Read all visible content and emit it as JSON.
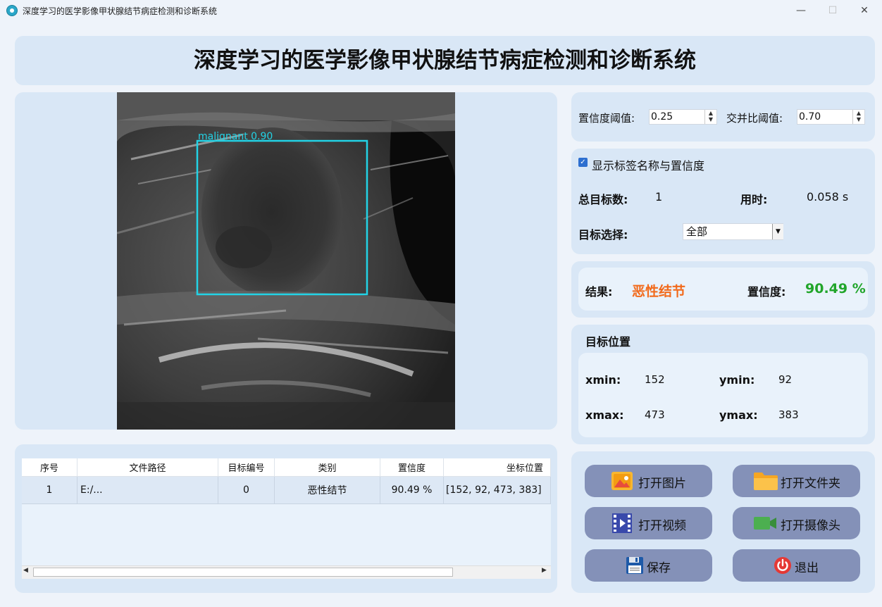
{
  "window": {
    "title": "深度学习的医学影像甲状腺结节病症检测和诊断系统",
    "min_glyph": "—",
    "max_glyph": "☐",
    "close_glyph": "✕"
  },
  "header": {
    "title": "深度学习的医学影像甲状腺结节病症检测和诊断系统"
  },
  "image": {
    "detection_label": "malignant 0.90",
    "box_color": "#22d3e6"
  },
  "thresholds": {
    "confidence_label": "置信度阈值:",
    "confidence_value": "0.25",
    "iou_label": "交并比阈值:",
    "iou_value": "0.70"
  },
  "options": {
    "show_labels_text": "显示标签名称与置信度",
    "show_labels_checked": true,
    "total_label": "总目标数:",
    "total_value": "1",
    "time_label": "用时:",
    "time_value": "0.058 s",
    "target_select_label": "目标选择:",
    "target_select_value": "全部"
  },
  "result": {
    "label": "结果:",
    "value": "恶性结节",
    "value_color": "#f26a1b",
    "conf_label": "置信度:",
    "conf_value": "90.49 %",
    "conf_color": "#21a52a"
  },
  "position": {
    "title": "目标位置",
    "xmin_label": "xmin:",
    "xmin": "152",
    "ymin_label": "ymin:",
    "ymin": "92",
    "xmax_label": "xmax:",
    "xmax": "473",
    "ymax_label": "ymax:",
    "ymax": "383"
  },
  "table": {
    "headers": [
      "序号",
      "文件路径",
      "目标编号",
      "类别",
      "置信度",
      "坐标位置"
    ],
    "rows": [
      [
        "1",
        "E:/...",
        "0",
        "恶性结节",
        "90.49 %",
        "[152, 92, 473, 383]"
      ]
    ]
  },
  "buttons": {
    "open_image": "打开图片",
    "open_folder": "打开文件夹",
    "open_video": "打开视频",
    "open_camera": "打开摄像头",
    "save": "保存",
    "exit": "退出"
  }
}
